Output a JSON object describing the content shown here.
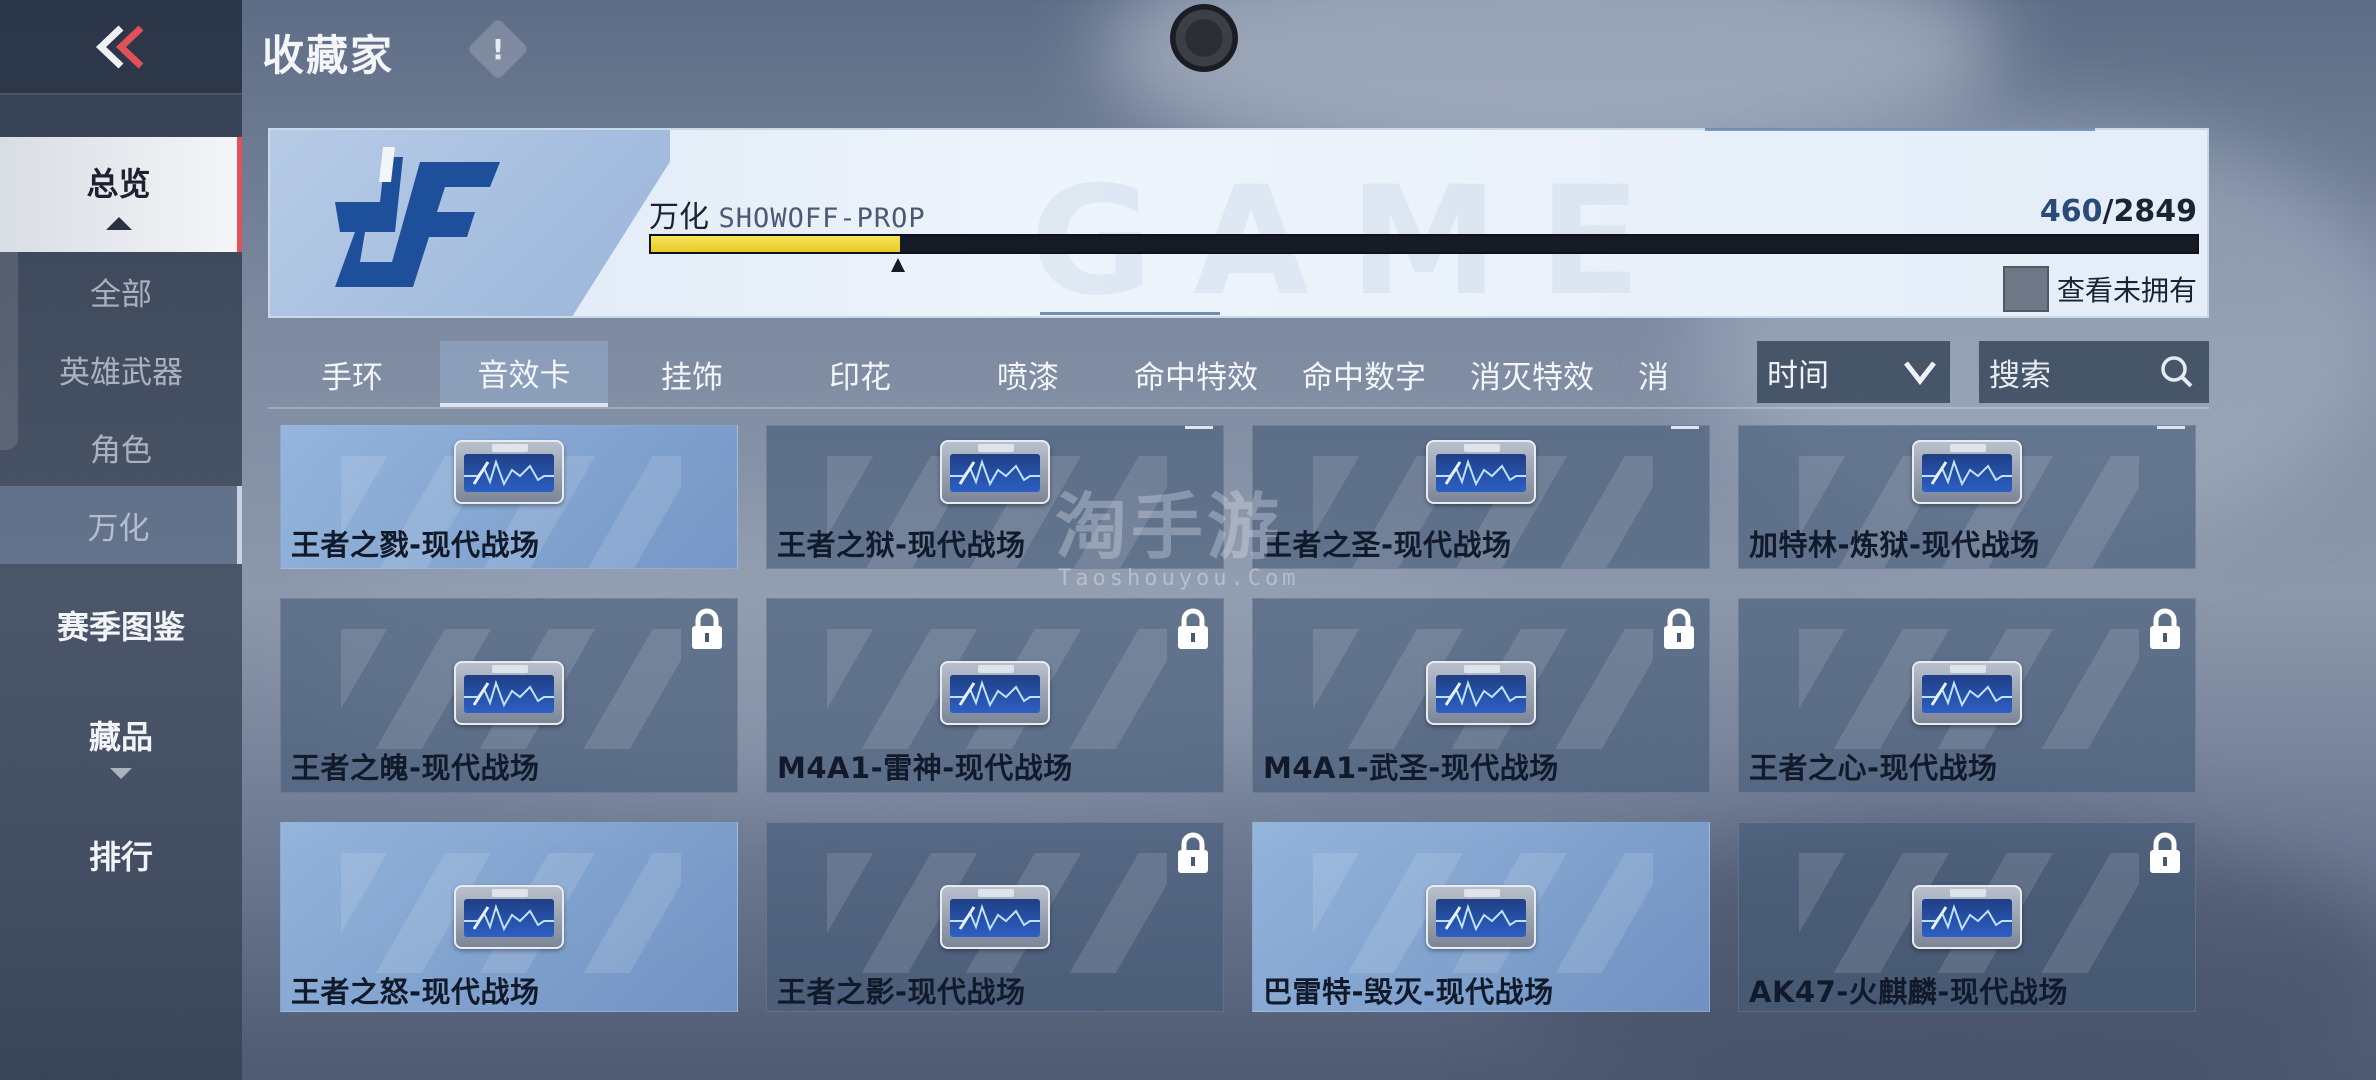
{
  "header": {
    "title": "收藏家",
    "info_symbol": "!"
  },
  "sidebar": {
    "items": [
      {
        "label": "总览",
        "state": "selected"
      },
      {
        "label": "全部"
      },
      {
        "label": "英雄武器"
      },
      {
        "label": "角色"
      },
      {
        "label": "万化",
        "state": "active"
      },
      {
        "label": "赛季图鉴"
      },
      {
        "label": "藏品"
      },
      {
        "label": "排行"
      }
    ]
  },
  "banner": {
    "logo_icon": "cf-logo",
    "label": "万化",
    "label_sub": "SHOWOFF-PROP",
    "current": "460",
    "separator": "/",
    "total": "2849",
    "progress_fraction": 0.161,
    "unowned_label": "查看未拥有",
    "ghost_text": "GAME"
  },
  "tabs": [
    {
      "label": "手环"
    },
    {
      "label": "音效卡",
      "active": true
    },
    {
      "label": "挂饰"
    },
    {
      "label": "印花"
    },
    {
      "label": "喷漆"
    },
    {
      "label": "命中特效"
    },
    {
      "label": "命中数字"
    },
    {
      "label": "消灭特效"
    },
    {
      "label": "消"
    }
  ],
  "sort": {
    "label": "时间",
    "icon": "chevron-down-icon"
  },
  "search": {
    "placeholder": "搜索",
    "icon": "search-icon"
  },
  "items": [
    {
      "name": "王者之戮-现代战场",
      "locked": false,
      "highlight": true
    },
    {
      "name": "王者之狱-现代战场",
      "locked": false,
      "highlight": false
    },
    {
      "name": "王者之圣-现代战场",
      "locked": false,
      "highlight": false
    },
    {
      "name": "加特林-炼狱-现代战场",
      "locked": false,
      "highlight": false
    },
    {
      "name": "王者之魄-现代战场",
      "locked": true,
      "highlight": false
    },
    {
      "name": "M4A1-雷神-现代战场",
      "locked": true,
      "highlight": false
    },
    {
      "name": "M4A1-武圣-现代战场",
      "locked": true,
      "highlight": false
    },
    {
      "name": "王者之心-现代战场",
      "locked": true,
      "highlight": false
    },
    {
      "name": "王者之怒-现代战场",
      "locked": false,
      "highlight": true
    },
    {
      "name": "王者之影-现代战场",
      "locked": true,
      "highlight": false
    },
    {
      "name": "巴雷特-毁灭-现代战场",
      "locked": false,
      "highlight": true
    },
    {
      "name": "AK47-火麒麟-现代战场",
      "locked": true,
      "highlight": false
    }
  ],
  "watermark": {
    "title": "淘手游",
    "sub": "Taoshouyou.Com"
  },
  "colors": {
    "accent": "#e2505a",
    "progress": "#f2dc45",
    "card": "#465a78"
  }
}
